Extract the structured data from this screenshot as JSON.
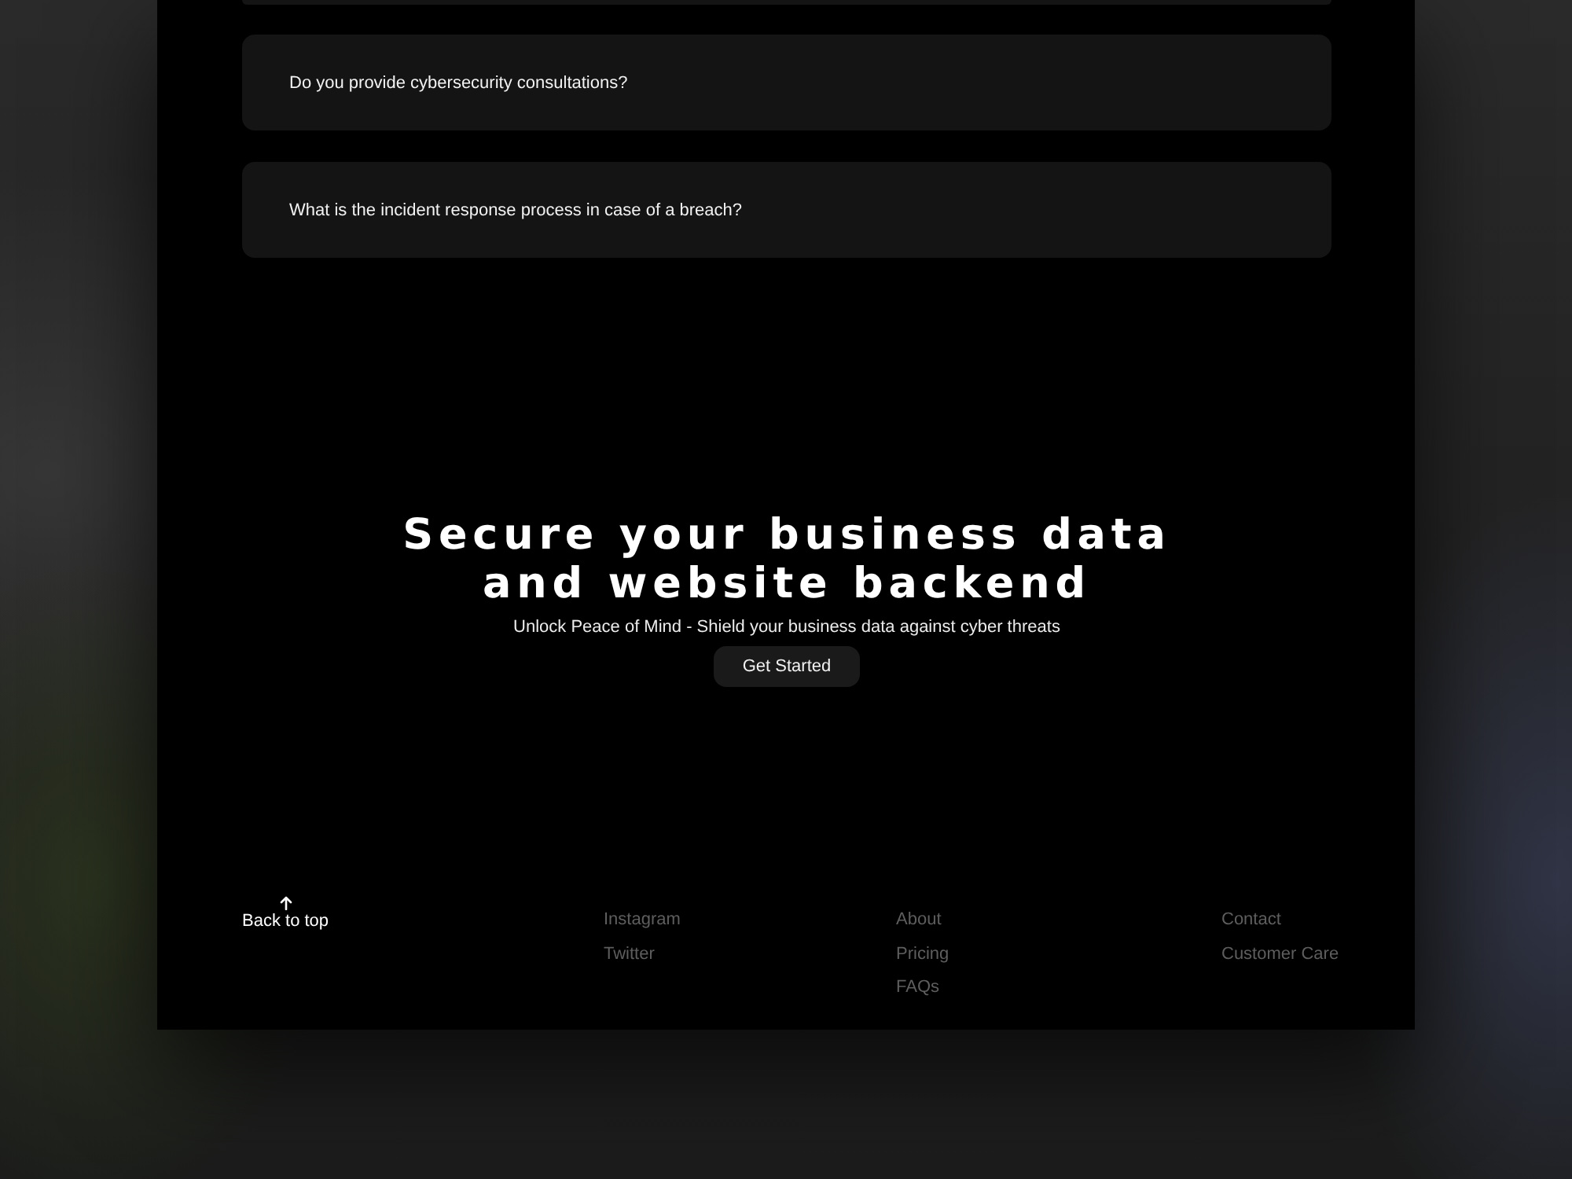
{
  "faq": {
    "items": [
      {
        "question": "Do you provide cybersecurity consultations?"
      },
      {
        "question": "What is the incident response process in case of a breach?"
      }
    ]
  },
  "hero": {
    "title": "Secure your business data and website backend",
    "subtitle": "Unlock Peace of Mind - Shield your business data against cyber threats",
    "button": "Get Started"
  },
  "footer": {
    "back_to_top": "Back to top",
    "columns": [
      {
        "links": [
          "Instagram",
          "Twitter"
        ]
      },
      {
        "links": [
          "About",
          "Pricing",
          "FAQs"
        ]
      },
      {
        "links": [
          "Contact",
          "Customer Care"
        ]
      }
    ]
  }
}
